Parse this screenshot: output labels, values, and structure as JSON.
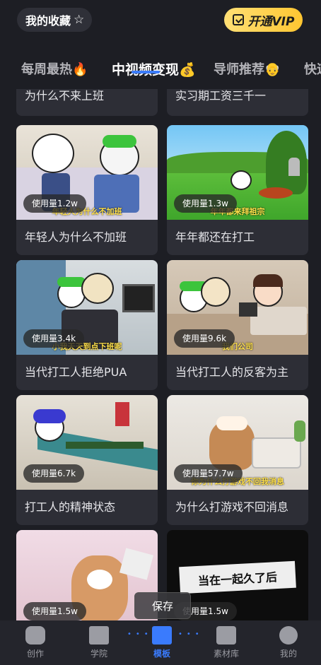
{
  "header": {
    "favorites_label": "我的收藏",
    "vip_label": "开通VIP"
  },
  "tabs": [
    {
      "label": "每周最热🔥"
    },
    {
      "label": "中视频变现💰"
    },
    {
      "label": "导师推荐👴"
    },
    {
      "label": "快速"
    }
  ],
  "cards": [
    {
      "title": "为什么不来上班",
      "usage": ""
    },
    {
      "title": "实习期工资三千一",
      "usage": ""
    },
    {
      "title": "年轻人为什么不加班",
      "usage": "使用量1.2w",
      "caption": "年轻人为什么不加班"
    },
    {
      "title": "年年都还在打工",
      "usage": "使用量1.3w",
      "caption": "年年都来拜祖宗"
    },
    {
      "title": "当代打工人拒绝PUA",
      "usage": "使用量3.4k",
      "caption": "小我天天到点下班呢"
    },
    {
      "title": "当代打工人的反客为主",
      "usage": "使用量9.6k",
      "caption": "我们公司"
    },
    {
      "title": "打工人的精神状态",
      "usage": "使用量6.7k",
      "caption": ""
    },
    {
      "title": "为什么打游戏不回消息",
      "usage": "使用量57.7w",
      "caption": "你为什么打游戏不回我消息"
    },
    {
      "title": "",
      "usage": "使用量1.5w",
      "caption": ""
    },
    {
      "title": "",
      "usage": "使用量1.5w",
      "caption": "当在一起久了后"
    }
  ],
  "save_label": "保存",
  "nav": [
    {
      "label": "创作",
      "icon": "face-icon"
    },
    {
      "label": "学院",
      "icon": "book-icon"
    },
    {
      "label": "模板",
      "icon": "template-icon"
    },
    {
      "label": "素材库",
      "icon": "store-icon"
    },
    {
      "label": "我的",
      "icon": "user-icon"
    }
  ],
  "colors": {
    "accent": "#3a7bfd",
    "vip": "#ffc631",
    "background": "#1d1e24",
    "card": "#2d2e36"
  }
}
